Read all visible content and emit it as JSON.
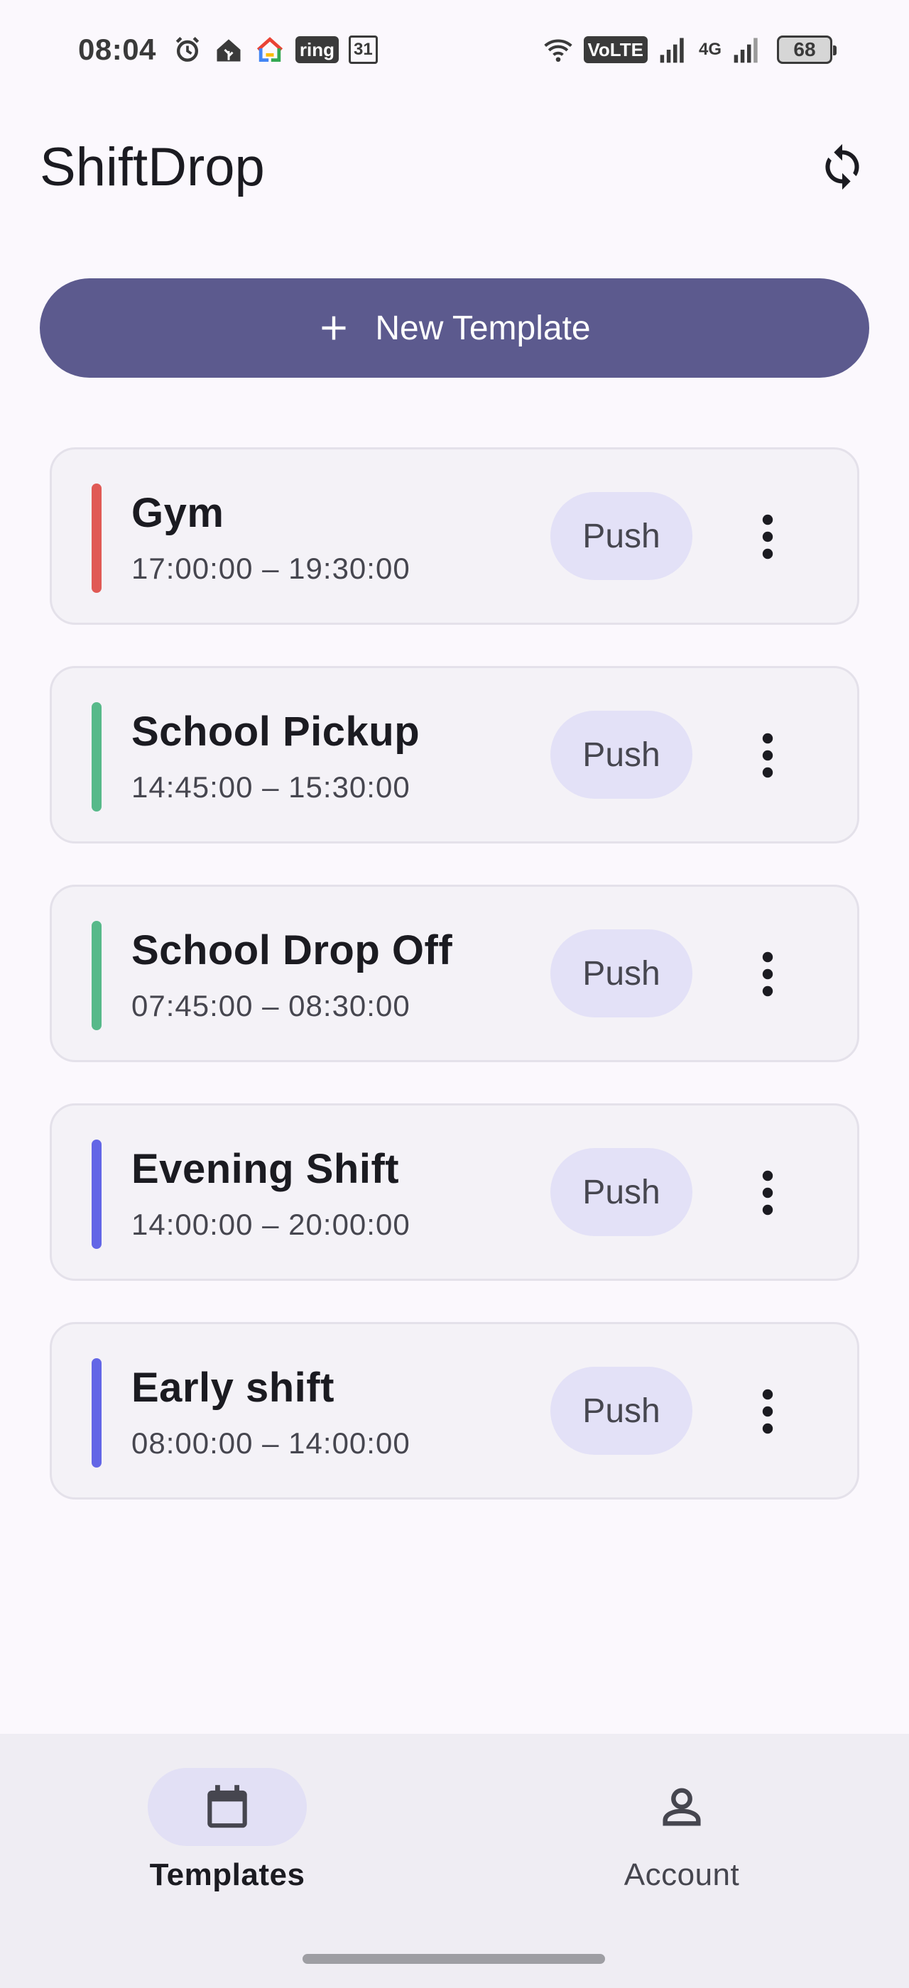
{
  "status_bar": {
    "time": "08:04",
    "volte": "VoLTE",
    "network": "4G",
    "calendar_day": "31",
    "ring": "ring",
    "battery": "68"
  },
  "app_bar": {
    "title": "ShiftDrop",
    "sync_icon": "sync-icon"
  },
  "new_template": {
    "label": "New Template",
    "icon": "plus-icon",
    "color": "#5c5a8e"
  },
  "templates": [
    {
      "name": "Gym",
      "time": "17:00:00 – 19:30:00",
      "color": "#e05a55",
      "push": "Push"
    },
    {
      "name": "School Pickup",
      "time": "14:45:00 – 15:30:00",
      "color": "#57b98a",
      "push": "Push"
    },
    {
      "name": "School Drop Off",
      "time": "07:45:00 – 08:30:00",
      "color": "#57b98a",
      "push": "Push"
    },
    {
      "name": "Evening Shift",
      "time": "14:00:00 – 20:00:00",
      "color": "#6366e6",
      "push": "Push"
    },
    {
      "name": "Early shift",
      "time": "08:00:00 – 14:00:00",
      "color": "#6366e6",
      "push": "Push"
    }
  ],
  "bottom_nav": {
    "templates": {
      "label": "Templates",
      "icon": "calendar-icon",
      "active": true
    },
    "account": {
      "label": "Account",
      "icon": "person-icon",
      "active": false
    }
  }
}
